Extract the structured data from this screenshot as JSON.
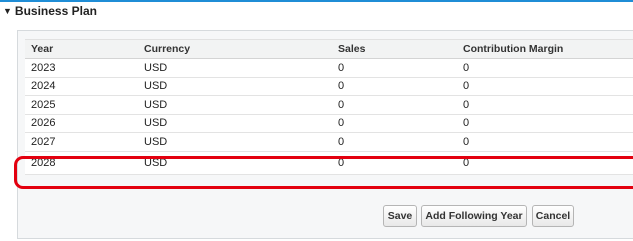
{
  "section": {
    "toggle_glyph": "▼",
    "title": "Business Plan"
  },
  "table": {
    "columns": [
      "Year",
      "Currency",
      "Sales",
      "Contribution Margin"
    ],
    "rows": [
      [
        "2023",
        "USD",
        "0",
        "0"
      ],
      [
        "2024",
        "USD",
        "0",
        "0"
      ],
      [
        "2025",
        "USD",
        "0",
        "0"
      ],
      [
        "2026",
        "USD",
        "0",
        "0"
      ],
      [
        "2027",
        "USD",
        "0",
        "0"
      ],
      [
        "2028",
        "USD",
        "0",
        "0"
      ]
    ],
    "highlighted_row_year": "2028"
  },
  "buttons": {
    "save": "Save",
    "add_following_year": "Add Following Year",
    "cancel": "Cancel"
  },
  "colors": {
    "header_accent": "#1f8dd6",
    "highlight_outline": "#e3000f"
  }
}
